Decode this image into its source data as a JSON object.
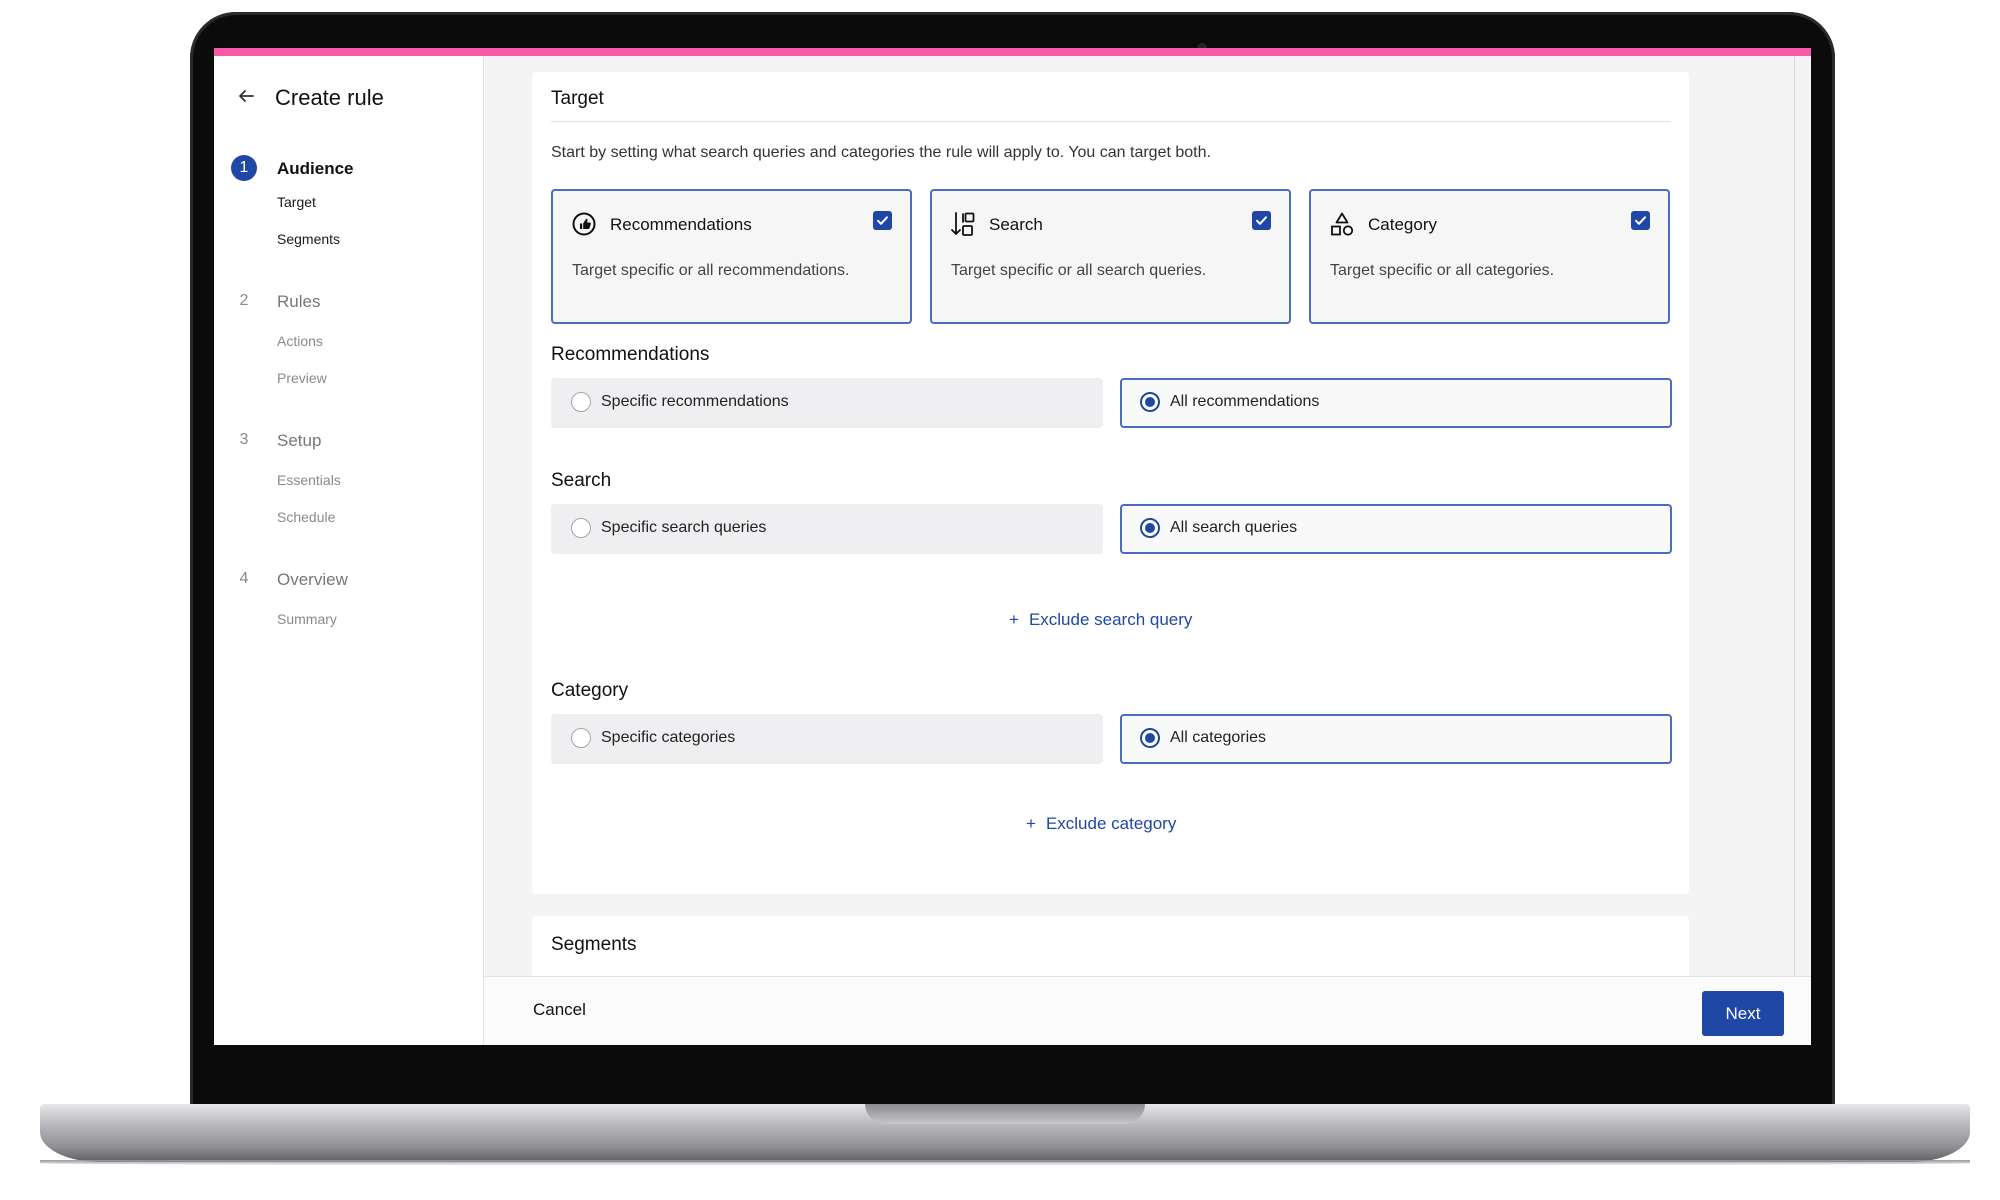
{
  "header": {
    "title": "Create rule"
  },
  "steps": [
    {
      "num": "1",
      "label": "Audience",
      "subs": [
        "Target",
        "Segments"
      ]
    },
    {
      "num": "2",
      "label": "Rules",
      "subs": [
        "Actions",
        "Preview"
      ]
    },
    {
      "num": "3",
      "label": "Setup",
      "subs": [
        "Essentials",
        "Schedule"
      ]
    },
    {
      "num": "4",
      "label": "Overview",
      "subs": [
        "Summary"
      ]
    }
  ],
  "target": {
    "title": "Target",
    "intro": "Start by setting what search queries and categories the rule will apply to. You can target both.",
    "cards": [
      {
        "title": "Recommendations",
        "desc": "Target specific or all recommendations.",
        "icon": "recommendations-icon",
        "checked": true
      },
      {
        "title": "Search",
        "desc": "Target specific or all search queries.",
        "icon": "sort-search-icon",
        "checked": true
      },
      {
        "title": "Category",
        "desc": "Target specific or all categories.",
        "icon": "shapes-icon",
        "checked": true
      }
    ]
  },
  "recommendations": {
    "title": "Recommendations",
    "specific": "Specific recommendations",
    "all": "All recommendations",
    "selected": "all"
  },
  "search": {
    "title": "Search",
    "specific": "Specific search queries",
    "all": "All search queries",
    "selected": "all",
    "exclude": "Exclude search query"
  },
  "category": {
    "title": "Category",
    "specific": "Specific categories",
    "all": "All categories",
    "selected": "all",
    "exclude": "Exclude category"
  },
  "segments": {
    "title": "Segments"
  },
  "footer": {
    "cancel": "Cancel",
    "next": "Next"
  },
  "colors": {
    "accent": "#f65aa8",
    "primary": "#1f48a6",
    "selected_border": "#4b6cc1"
  }
}
